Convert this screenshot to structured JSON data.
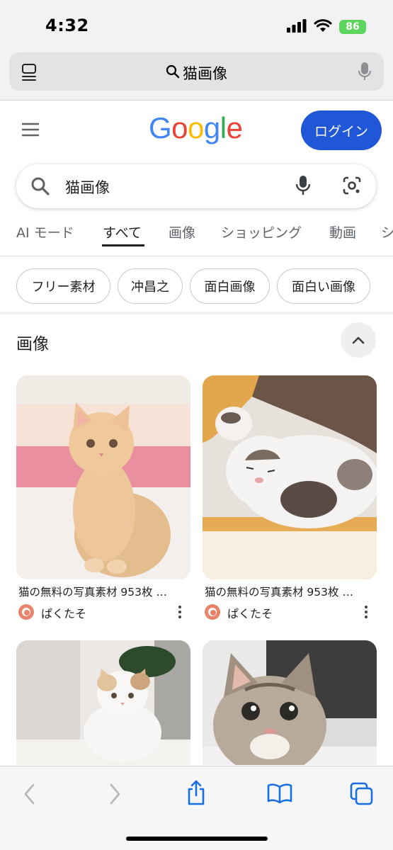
{
  "status_bar": {
    "time": "4:32",
    "battery": "86"
  },
  "url_bar": {
    "query": "猫画像"
  },
  "header": {
    "logo_letters": [
      {
        "ch": "G",
        "color": "#4285F4"
      },
      {
        "ch": "o",
        "color": "#EA4335"
      },
      {
        "ch": "o",
        "color": "#FBBC05"
      },
      {
        "ch": "g",
        "color": "#4285F4"
      },
      {
        "ch": "l",
        "color": "#34A853"
      },
      {
        "ch": "e",
        "color": "#EA4335"
      }
    ],
    "login_label": "ログイン",
    "login_color": "#1F57D6"
  },
  "search": {
    "query": "猫画像"
  },
  "tabs": [
    {
      "label": "AI モード"
    },
    {
      "label": "すべて",
      "active": true
    },
    {
      "label": "画像"
    },
    {
      "label": "ショッピング"
    },
    {
      "label": "動画"
    },
    {
      "label": "ショ"
    }
  ],
  "chips": [
    "フリー素材",
    "冲昌之",
    "面白画像",
    "面白い画像"
  ],
  "images_section": {
    "title": "画像",
    "results": [
      {
        "title": "猫の無料の写真素材 953枚 …",
        "source": "ぱくたそ"
      },
      {
        "title": "猫の無料の写真素材 953枚 …",
        "source": "ぱくたそ"
      }
    ]
  },
  "toolbar": {
    "items": [
      "back-icon",
      "forward-icon",
      "share-icon",
      "bookmarks-icon",
      "tabs-icon"
    ]
  }
}
